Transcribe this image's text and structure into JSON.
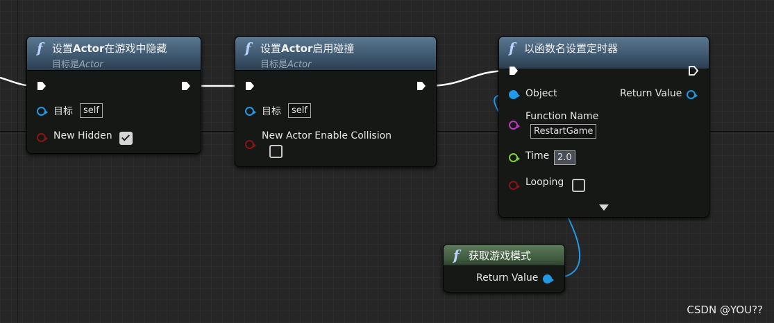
{
  "nodes": {
    "set_hidden": {
      "title_prefix": "设置",
      "title_bold": "Actor",
      "title_suffix": "在游戏中隐藏",
      "subtitle_prefix": "目标是",
      "subtitle_italic": "Actor",
      "target_label": "目标",
      "target_value": "self",
      "hidden_label": "New Hidden",
      "hidden_checked": true
    },
    "set_collision": {
      "title_prefix": "设置",
      "title_bold": "Actor",
      "title_suffix": "启用碰撞",
      "subtitle_prefix": "目标是",
      "subtitle_italic": "Actor",
      "target_label": "目标",
      "target_value": "self",
      "collision_label": "New Actor Enable Collision",
      "collision_checked": false
    },
    "set_timer": {
      "title": "以函数名设置定时器",
      "object_label": "Object",
      "return_label": "Return Value",
      "function_name_label": "Function Name",
      "function_name_value": "RestartGame",
      "time_label": "Time",
      "time_value": "2.0",
      "looping_label": "Looping",
      "looping_checked": false
    },
    "get_game_mode": {
      "title": "获取游戏模式",
      "return_label": "Return Value"
    }
  },
  "icons": {
    "function": "f",
    "function_icon": "function-icon",
    "exec_pin": "exec-pin-icon",
    "expand": "expand-arrow-icon"
  },
  "colors": {
    "object_pin": "#1f9ae8",
    "bool_pin": "#8a1414",
    "name_pin": "#c236c2",
    "float_pin": "#7ed33a",
    "function_header": "#3d566d",
    "pure_header": "#3f5a3d"
  },
  "watermark": "CSDN @YOU??"
}
